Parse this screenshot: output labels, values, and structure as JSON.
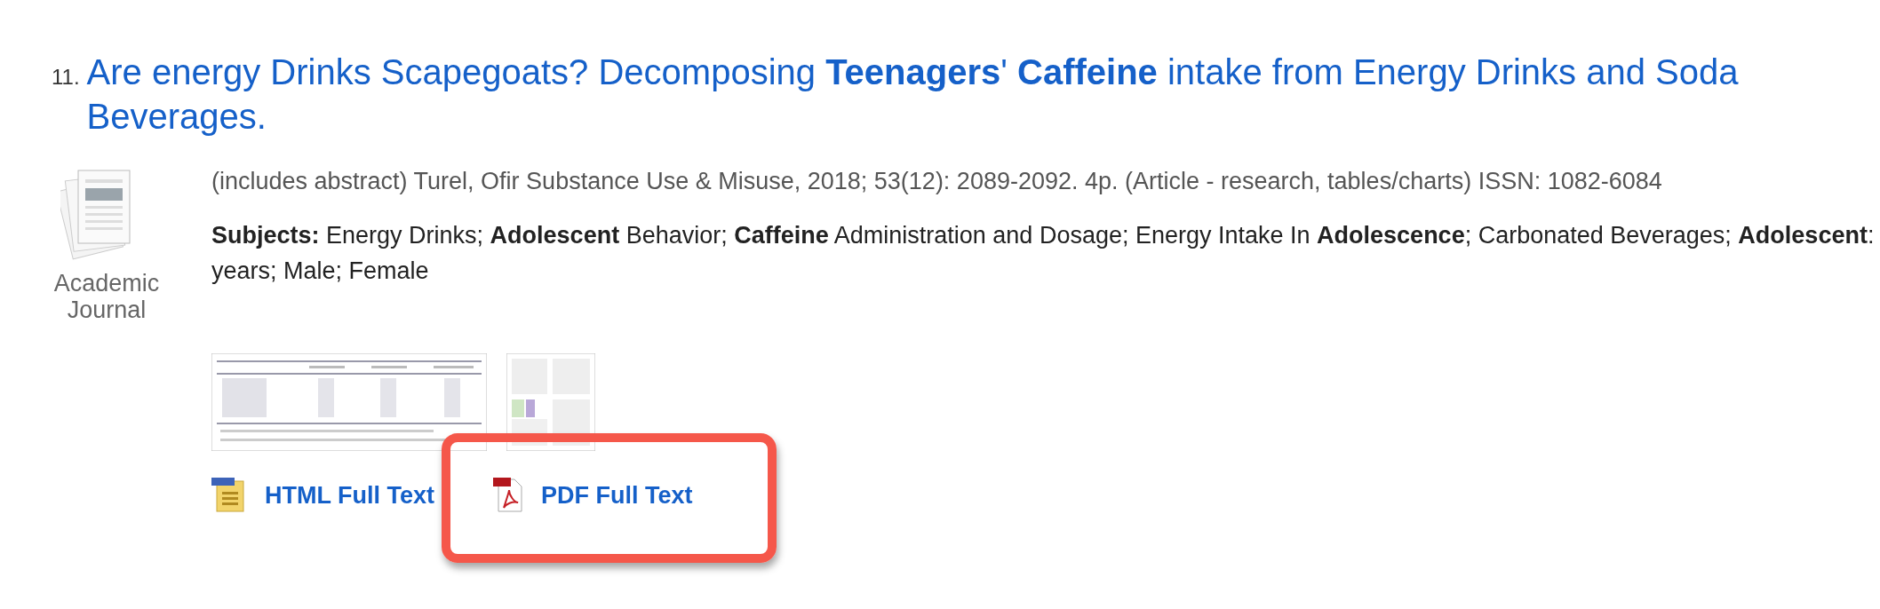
{
  "result": {
    "number": "11.",
    "title": "Are energy Drinks Scapegoats? Decomposing **Teenagers**' **Caffeine** intake from Energy Drinks and Soda Beverages.",
    "type_label": "Academic Journal",
    "source": "(includes abstract) Turel, Ofir Substance Use & Misuse, 2018; 53(12): 2089-2092. 4p. (Article - research, tables/charts) ISSN: 1082-6084",
    "subjects": "**Subjects:** Energy Drinks; **Adolescent** Behavior; **Caffeine** Administration and Dosage; Energy Intake In **Adolescence**; Carbonated Beverages; **Adolescent**: years; Male; Female",
    "thumbnails": [
      {
        "kind": "table"
      },
      {
        "kind": "page"
      }
    ],
    "links": [
      {
        "kind": "html",
        "label": "HTML Full Text",
        "highlighted": false
      },
      {
        "kind": "pdf",
        "label": "PDF Full Text",
        "highlighted": true
      }
    ]
  }
}
